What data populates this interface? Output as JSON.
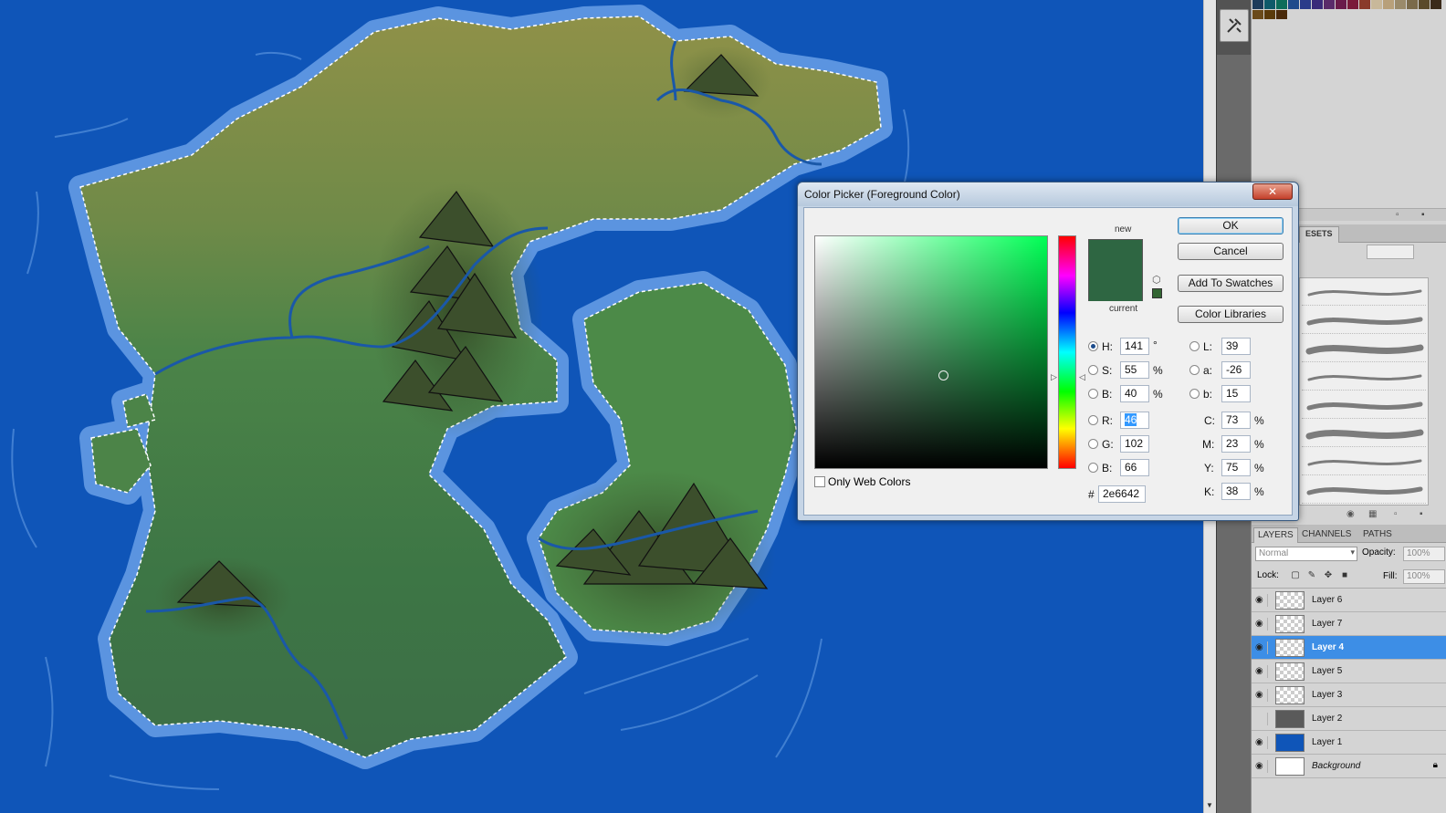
{
  "colors": {
    "new": "#2e6642",
    "current": "#2e6642",
    "websafe": "#336633",
    "selected_layer": "#3d8ee6",
    "canvas_water": "#0f55b8"
  },
  "dialog": {
    "title": "Color Picker (Foreground Color)",
    "close_icon": "close-x-icon",
    "close_glyph": "✕",
    "new_label": "new",
    "current_label": "current",
    "buttons": {
      "ok": "OK",
      "cancel": "Cancel",
      "add_to_swatches": "Add To Swatches",
      "color_libraries": "Color Libraries"
    },
    "hsb": {
      "h": {
        "label": "H:",
        "value": "141",
        "unit": "°"
      },
      "s": {
        "label": "S:",
        "value": "55",
        "unit": "%"
      },
      "b": {
        "label": "B:",
        "value": "40",
        "unit": "%"
      }
    },
    "rgb": {
      "r": {
        "label": "R:",
        "value": "46"
      },
      "g": {
        "label": "G:",
        "value": "102"
      },
      "b": {
        "label": "B:",
        "value": "66"
      }
    },
    "lab": {
      "l": {
        "label": "L:",
        "value": "39"
      },
      "a": {
        "label": "a:",
        "value": "-26"
      },
      "b": {
        "label": "b:",
        "value": "15"
      }
    },
    "cmyk": {
      "c": {
        "label": "C:",
        "value": "73",
        "unit": "%"
      },
      "m": {
        "label": "M:",
        "value": "23",
        "unit": "%"
      },
      "y": {
        "label": "Y:",
        "value": "75",
        "unit": "%"
      },
      "k": {
        "label": "K:",
        "value": "38",
        "unit": "%"
      }
    },
    "hex": {
      "label": "#",
      "value": "2e6642"
    },
    "only_web_colors": "Only Web Colors",
    "selected_mode": "H"
  },
  "brushes_panel": {
    "tab_label": "ESETS"
  },
  "layers_panel": {
    "tabs": [
      "LAYERS",
      "CHANNELS",
      "PATHS"
    ],
    "blend_mode": "Normal",
    "opacity_label": "Opacity:",
    "opacity_value": "100%",
    "lock_label": "Lock:",
    "fill_label": "Fill:",
    "fill_value": "100%",
    "layers": [
      {
        "name": "Layer 6",
        "visible": true,
        "selected": false
      },
      {
        "name": "Layer 7",
        "visible": true,
        "selected": false
      },
      {
        "name": "Layer 4",
        "visible": true,
        "selected": true
      },
      {
        "name": "Layer 5",
        "visible": true,
        "selected": false
      },
      {
        "name": "Layer 3",
        "visible": true,
        "selected": false
      },
      {
        "name": "Layer 2",
        "visible": false,
        "selected": false
      },
      {
        "name": "Layer 1",
        "visible": true,
        "selected": false
      },
      {
        "name": "Background",
        "visible": true,
        "selected": false,
        "locked": true
      }
    ]
  }
}
